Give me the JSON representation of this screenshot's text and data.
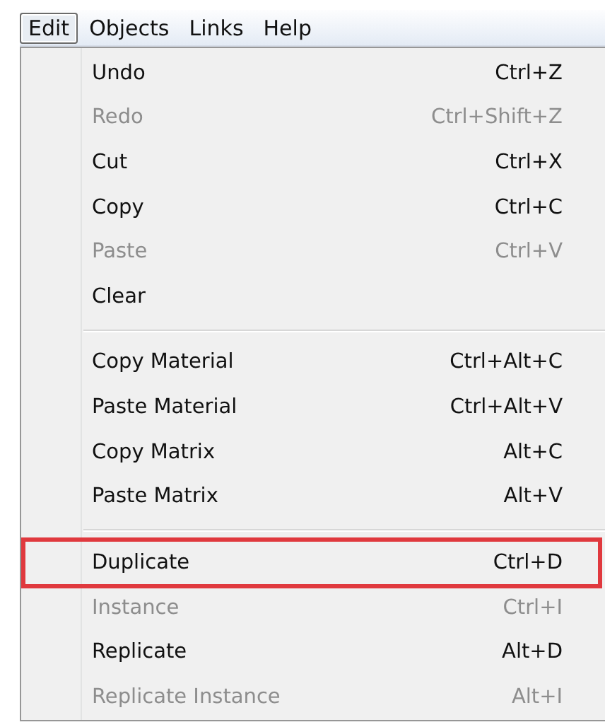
{
  "menu_bar": [
    {
      "label": "Edit",
      "selected": true
    },
    {
      "label": "Objects",
      "selected": false
    },
    {
      "label": "Links",
      "selected": false
    },
    {
      "label": "Help",
      "selected": false
    }
  ],
  "menu": {
    "groups": [
      {
        "items": [
          {
            "label": "Undo",
            "shortcut": "Ctrl+Z",
            "disabled": false,
            "highlighted": false
          },
          {
            "label": "Redo",
            "shortcut": "Ctrl+Shift+Z",
            "disabled": true,
            "highlighted": false
          },
          {
            "label": "Cut",
            "shortcut": "Ctrl+X",
            "disabled": false,
            "highlighted": false
          },
          {
            "label": "Copy",
            "shortcut": "Ctrl+C",
            "disabled": false,
            "highlighted": false
          },
          {
            "label": "Paste",
            "shortcut": "Ctrl+V",
            "disabled": true,
            "highlighted": false
          },
          {
            "label": "Clear",
            "disabled": false,
            "highlighted": false
          }
        ]
      },
      {
        "items": [
          {
            "label": "Copy Material",
            "shortcut": "Ctrl+Alt+C",
            "disabled": false,
            "highlighted": false
          },
          {
            "label": "Paste Material",
            "shortcut": "Ctrl+Alt+V",
            "disabled": false,
            "highlighted": false
          },
          {
            "label": "Copy Matrix",
            "shortcut": "Alt+C",
            "disabled": false,
            "highlighted": false
          },
          {
            "label": "Paste Matrix",
            "shortcut": "Alt+V",
            "disabled": false,
            "highlighted": false
          }
        ]
      },
      {
        "items": [
          {
            "label": "Duplicate",
            "shortcut": "Ctrl+D",
            "disabled": false,
            "highlighted": true
          },
          {
            "label": "Instance",
            "shortcut": "Ctrl+I",
            "disabled": true,
            "highlighted": false
          },
          {
            "label": "Replicate",
            "shortcut": "Alt+D",
            "disabled": false,
            "highlighted": false
          },
          {
            "label": "Replicate Instance",
            "shortcut": "Alt+I",
            "disabled": true,
            "highlighted": false
          }
        ]
      }
    ]
  }
}
